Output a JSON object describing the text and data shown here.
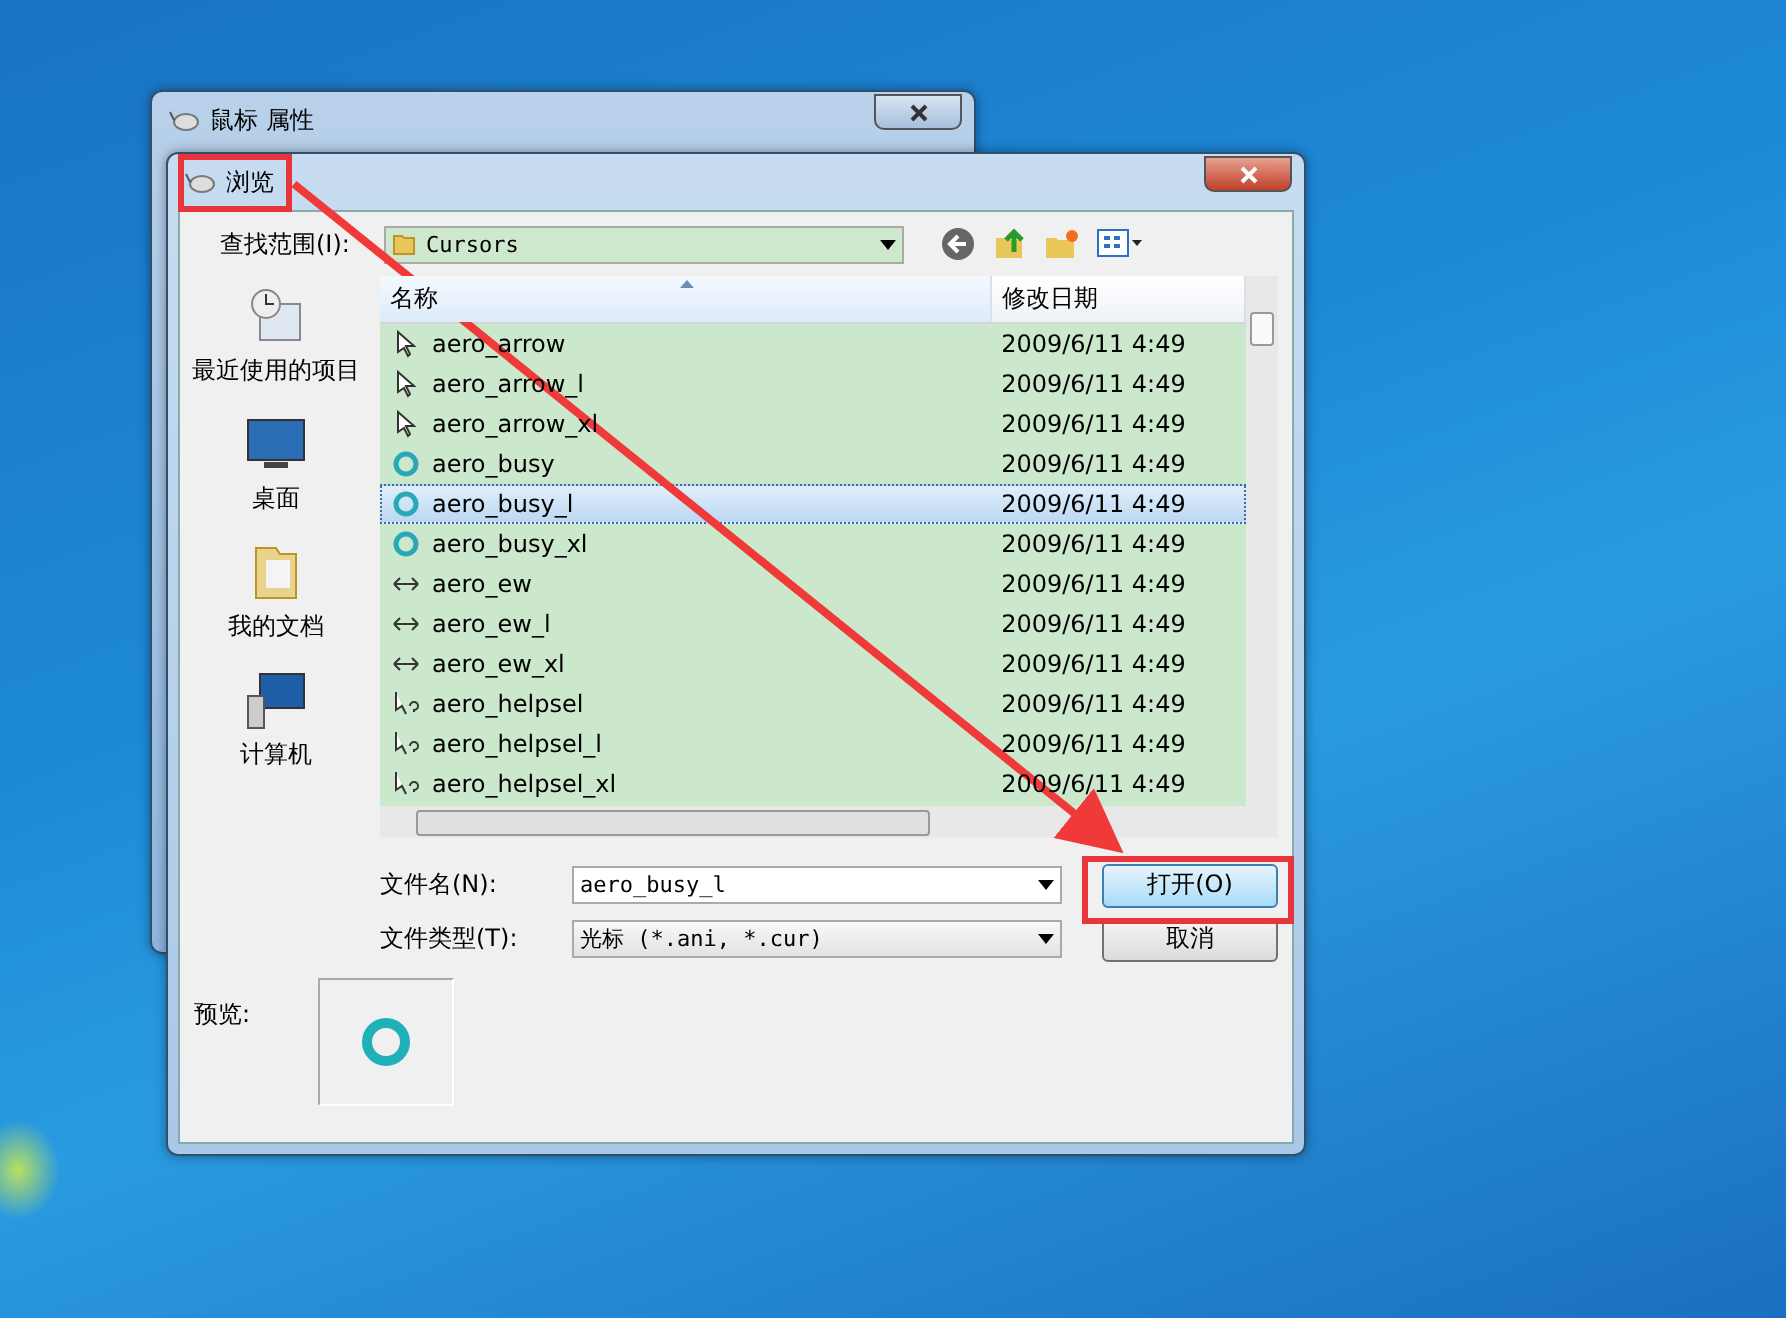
{
  "back_window": {
    "title": "鼠标 属性"
  },
  "dialog": {
    "title": "浏览"
  },
  "look_in": {
    "label": "查找范围(I):",
    "value": "Cursors"
  },
  "places": [
    {
      "label": "最近使用的项目",
      "kind": "recent"
    },
    {
      "label": "桌面",
      "kind": "desktop"
    },
    {
      "label": "我的文档",
      "kind": "documents"
    },
    {
      "label": "计算机",
      "kind": "computer"
    }
  ],
  "file_list": {
    "columns": [
      {
        "label": "名称",
        "sorted": true
      },
      {
        "label": "修改日期",
        "sorted": false
      }
    ],
    "rows": [
      {
        "name": "aero_arrow",
        "date": "2009/6/11 4:49",
        "kind": "arrow",
        "selected": false
      },
      {
        "name": "aero_arrow_l",
        "date": "2009/6/11 4:49",
        "kind": "arrow",
        "selected": false
      },
      {
        "name": "aero_arrow_xl",
        "date": "2009/6/11 4:49",
        "kind": "arrow",
        "selected": false
      },
      {
        "name": "aero_busy",
        "date": "2009/6/11 4:49",
        "kind": "busy",
        "selected": false
      },
      {
        "name": "aero_busy_l",
        "date": "2009/6/11 4:49",
        "kind": "busy",
        "selected": true
      },
      {
        "name": "aero_busy_xl",
        "date": "2009/6/11 4:49",
        "kind": "busy",
        "selected": false
      },
      {
        "name": "aero_ew",
        "date": "2009/6/11 4:49",
        "kind": "resize",
        "selected": false
      },
      {
        "name": "aero_ew_l",
        "date": "2009/6/11 4:49",
        "kind": "resize",
        "selected": false
      },
      {
        "name": "aero_ew_xl",
        "date": "2009/6/11 4:49",
        "kind": "resize",
        "selected": false
      },
      {
        "name": "aero_helpsel",
        "date": "2009/6/11 4:49",
        "kind": "help",
        "selected": false
      },
      {
        "name": "aero_helpsel_l",
        "date": "2009/6/11 4:49",
        "kind": "help",
        "selected": false
      },
      {
        "name": "aero_helpsel_xl",
        "date": "2009/6/11 4:49",
        "kind": "help",
        "selected": false
      }
    ]
  },
  "file_name": {
    "label": "文件名(N):",
    "value": "aero_busy_l"
  },
  "file_type": {
    "label": "文件类型(T):",
    "value": "光标 (*.ani, *.cur)"
  },
  "buttons": [
    {
      "label": "打开(O)",
      "kind": "default"
    },
    {
      "label": "取消",
      "kind": "normal"
    }
  ],
  "preview": {
    "label": "预览:"
  }
}
